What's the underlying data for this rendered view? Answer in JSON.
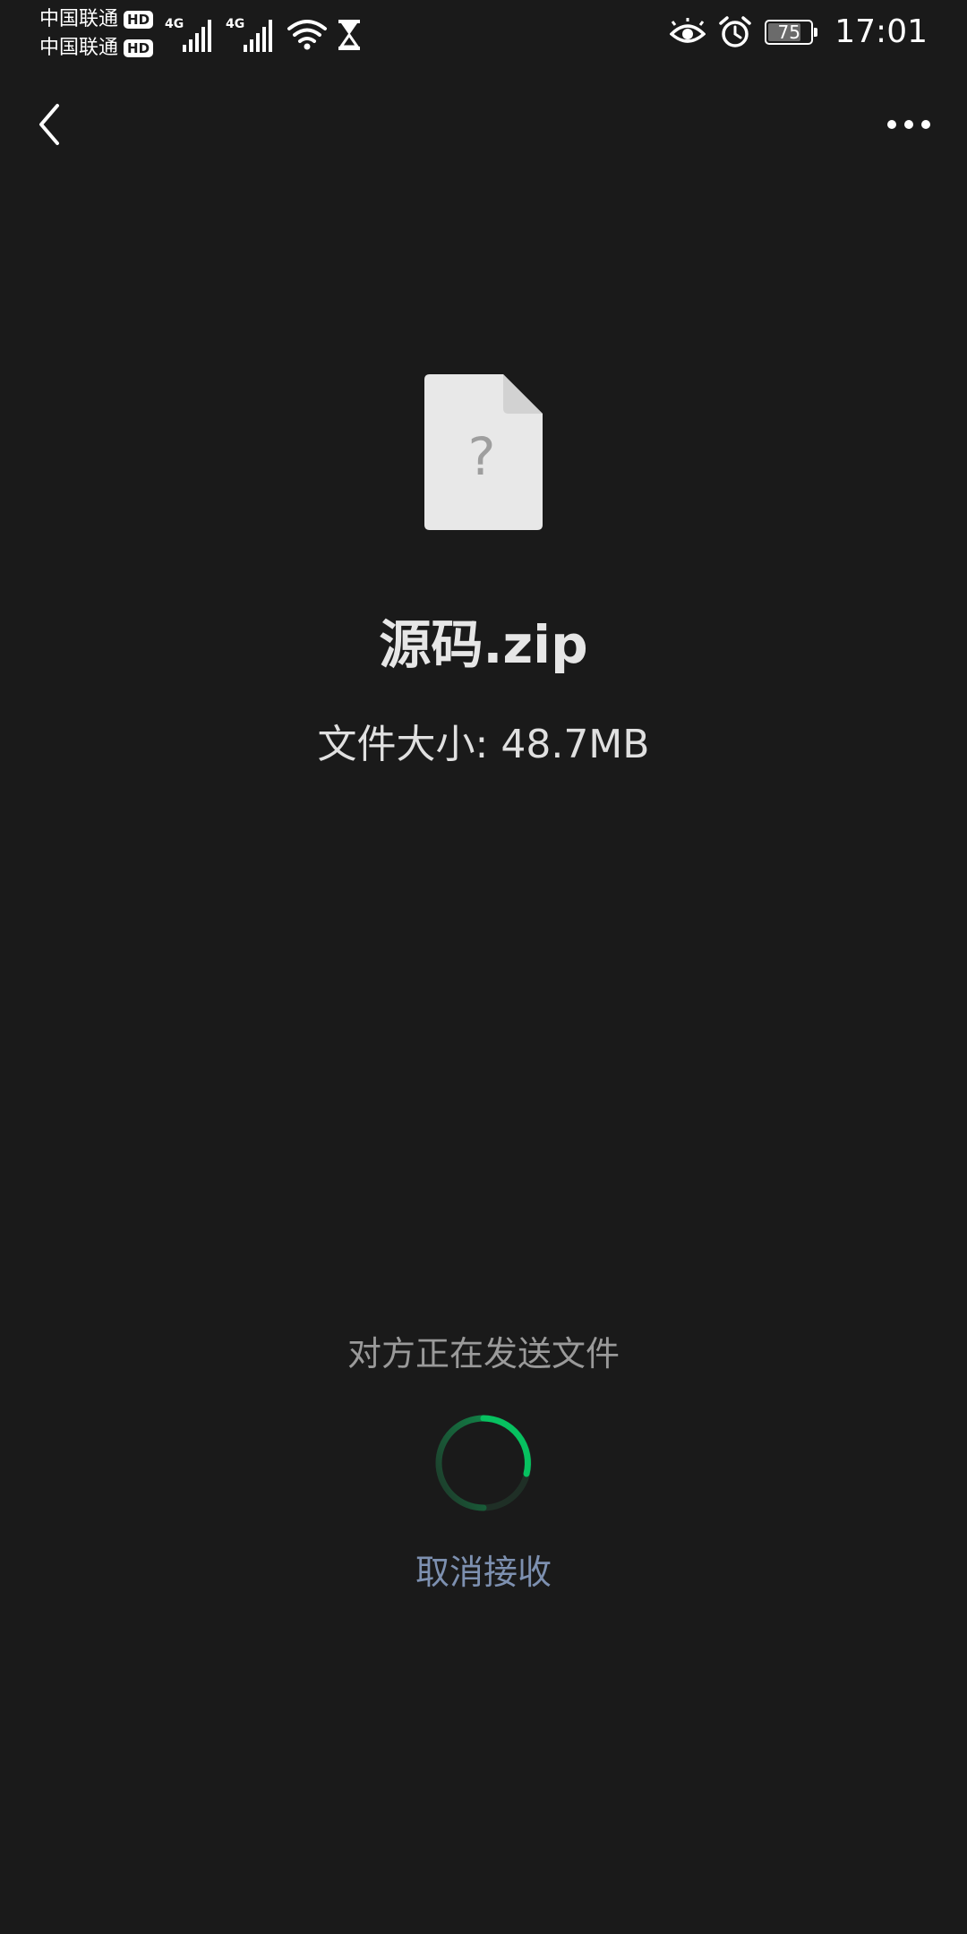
{
  "status_bar": {
    "carriers": [
      {
        "name": "中国联通",
        "badge": "HD"
      },
      {
        "name": "中国联通",
        "badge": "HD"
      }
    ],
    "network_labels": [
      "4G",
      "4G"
    ],
    "battery_level": "75",
    "time": "17:01"
  },
  "nav": {
    "back_icon": "chevron-left-icon",
    "more_icon": "more-horizontal-icon"
  },
  "file": {
    "icon": "unknown-file-icon",
    "icon_glyph": "?",
    "name": "源码.zip",
    "size": "文件大小: 48.7MB"
  },
  "transfer": {
    "status": "对方正在发送文件",
    "cancel_label": "取消接收",
    "spinner_color": "#07c160"
  },
  "colors": {
    "background": "#1a1a1a",
    "accent_green": "#07c160",
    "link_blue": "#7d90b0"
  }
}
